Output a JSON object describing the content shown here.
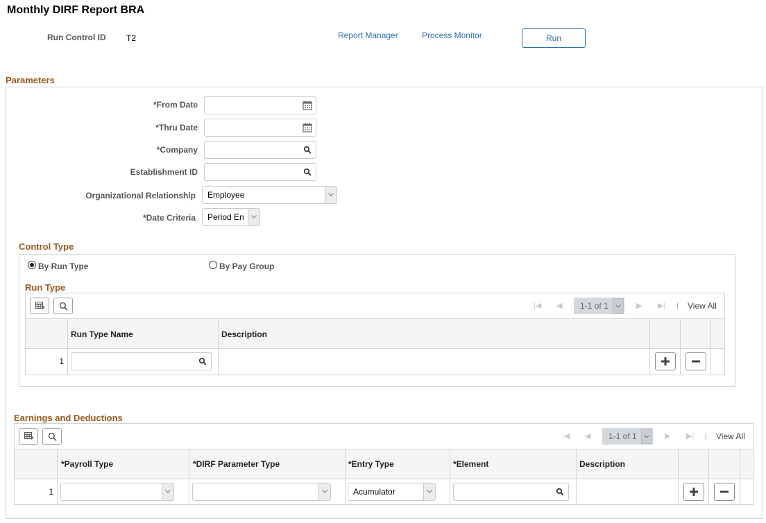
{
  "page": {
    "title": "Monthly DIRF Report BRA"
  },
  "header": {
    "run_control_label": "Run Control ID",
    "run_control_value": "T2",
    "report_manager_link": "Report Manager",
    "process_monitor_link": "Process Monitor",
    "run_button": "Run"
  },
  "parameters": {
    "section_title": "Parameters",
    "from_date": {
      "label": "*From Date",
      "value": ""
    },
    "thru_date": {
      "label": "*Thru Date",
      "value": ""
    },
    "company": {
      "label": "*Company",
      "value": ""
    },
    "establishment_id": {
      "label": "Establishment ID",
      "value": ""
    },
    "org_relationship": {
      "label": "Organizational Relationship",
      "value": "Employee"
    },
    "date_criteria": {
      "label": "*Date Criteria",
      "value": "Period En"
    }
  },
  "control_type": {
    "section_title": "Control Type",
    "options": [
      {
        "label": "By Run Type",
        "selected": true
      },
      {
        "label": "By Pay Group",
        "selected": false
      }
    ]
  },
  "run_type_grid": {
    "title": "Run Type",
    "pager": "1-1 of 1",
    "view_all": "View All",
    "separator": "|",
    "columns": [
      "Run Type Name",
      "Description"
    ],
    "rows": [
      {
        "num": "1",
        "run_type_name": "",
        "description": ""
      }
    ]
  },
  "earnings_grid": {
    "title": "Earnings and Deductions",
    "pager": "1-1 of 1",
    "view_all": "View All",
    "separator": "|",
    "columns": [
      "*Payroll Type",
      "*DIRF Parameter Type",
      "*Entry Type",
      "*Element",
      "Description"
    ],
    "rows": [
      {
        "num": "1",
        "payroll_type": "",
        "dirf_parameter_type": "",
        "entry_type": "Acumulator",
        "element": "",
        "description": ""
      }
    ]
  },
  "icons": {
    "calendar": "calendar-icon",
    "lookup": "search-icon",
    "dropdown": "chevron-down-icon",
    "personalize": "grid-personalize-icon",
    "find": "find-icon",
    "first": "first-page-icon",
    "prev": "previous-icon",
    "next": "next-icon",
    "last": "last-page-icon",
    "add_row": "plus-icon",
    "delete_row": "minus-icon"
  },
  "colors": {
    "section_heading": "#9a5a1c",
    "link": "#2a6ebb",
    "border": "#cfd4d9",
    "grid_header_bg": "#f5f5f5",
    "pager_bg": "#d3d8dd"
  }
}
